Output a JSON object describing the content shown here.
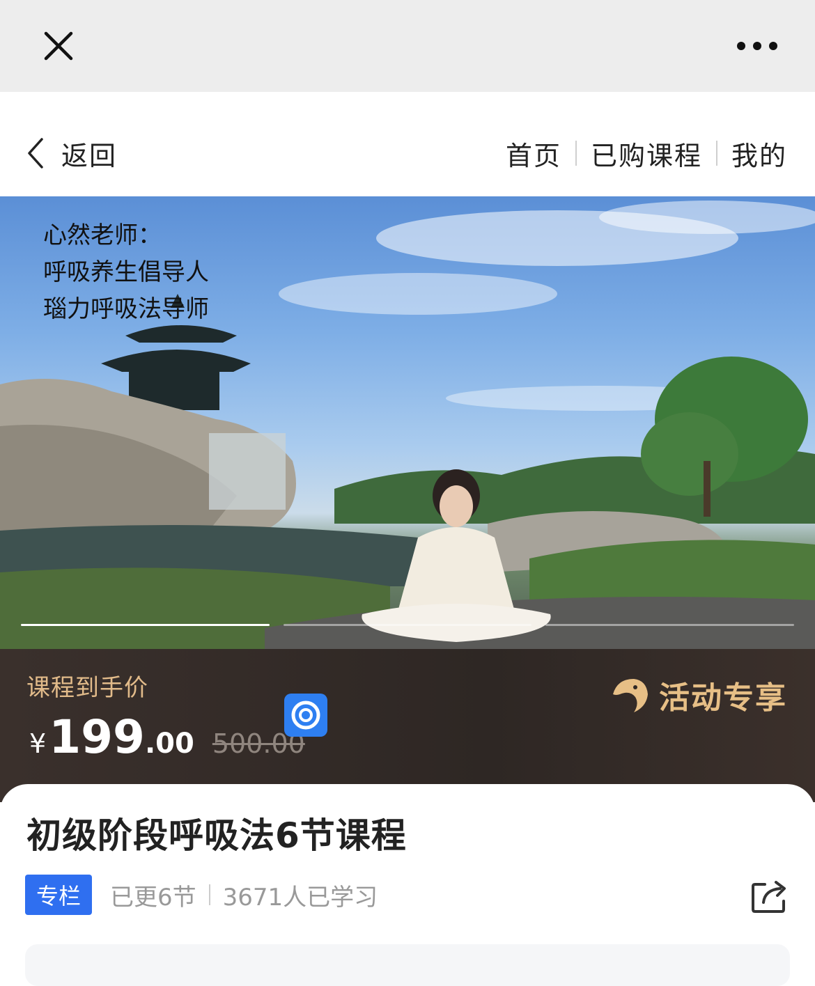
{
  "topbar": {
    "close_icon": "close-icon",
    "more_icon": "more-horizontal-icon"
  },
  "nav": {
    "back_label": "返回",
    "links": [
      "首页",
      "已购课程",
      "我的"
    ]
  },
  "hero": {
    "lines": [
      "心然老师：",
      "呼吸养生倡导人",
      "瑙力呼吸法导师"
    ],
    "carousel": {
      "count": 3,
      "active_index": 0
    }
  },
  "price": {
    "caption": "课程到手价",
    "currency": "¥",
    "integer": "199",
    "decimal": ".00",
    "original": "500.00",
    "promo_label": "活动专享",
    "accent_color": "#e7bf86"
  },
  "course": {
    "title": "初级阶段呼吸法6节课程",
    "tag": "专栏",
    "updated": "已更6节",
    "learners": "3671人已学习",
    "tag_color": "#2f6ff0"
  }
}
